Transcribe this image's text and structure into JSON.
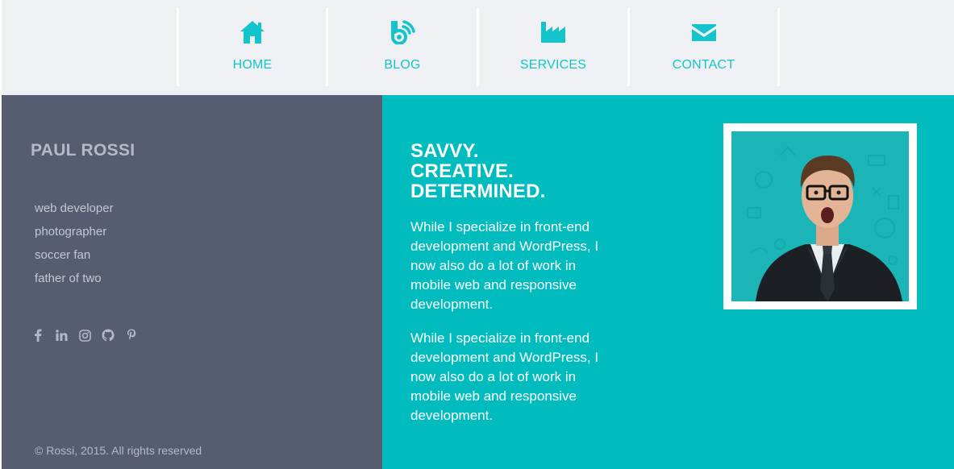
{
  "nav": {
    "items": [
      {
        "label": "HOME",
        "icon": "home-icon"
      },
      {
        "label": "BLOG",
        "icon": "blog-icon"
      },
      {
        "label": "SERVICES",
        "icon": "factory-icon"
      },
      {
        "label": "CONTACT",
        "icon": "envelope-icon"
      }
    ]
  },
  "sidebar": {
    "name": "PAUL ROSSI",
    "traits": [
      "web developer",
      "photographer",
      "soccer fan",
      "father of two"
    ],
    "socials": [
      "facebook-icon",
      "linkedin-icon",
      "instagram-icon",
      "github-icon",
      "pinterest-icon"
    ],
    "copyright": "© Rossi, 2015. All rights reserved"
  },
  "main": {
    "headline": [
      "SAVVY.",
      "CREATIVE.",
      "DETERMINED."
    ],
    "paragraphs": [
      "While I specialize in front-end development and WordPress, I now also do a lot of work in mobile web and responsive development.",
      "While I specialize in front-end development and WordPress, I now also do a lot of work in mobile web and responsive development."
    ]
  },
  "colors": {
    "accent": "#14c4cc",
    "nav_bg": "#eff0f4",
    "sidebar_bg": "#565d71",
    "main_bg": "#00bcbe"
  }
}
